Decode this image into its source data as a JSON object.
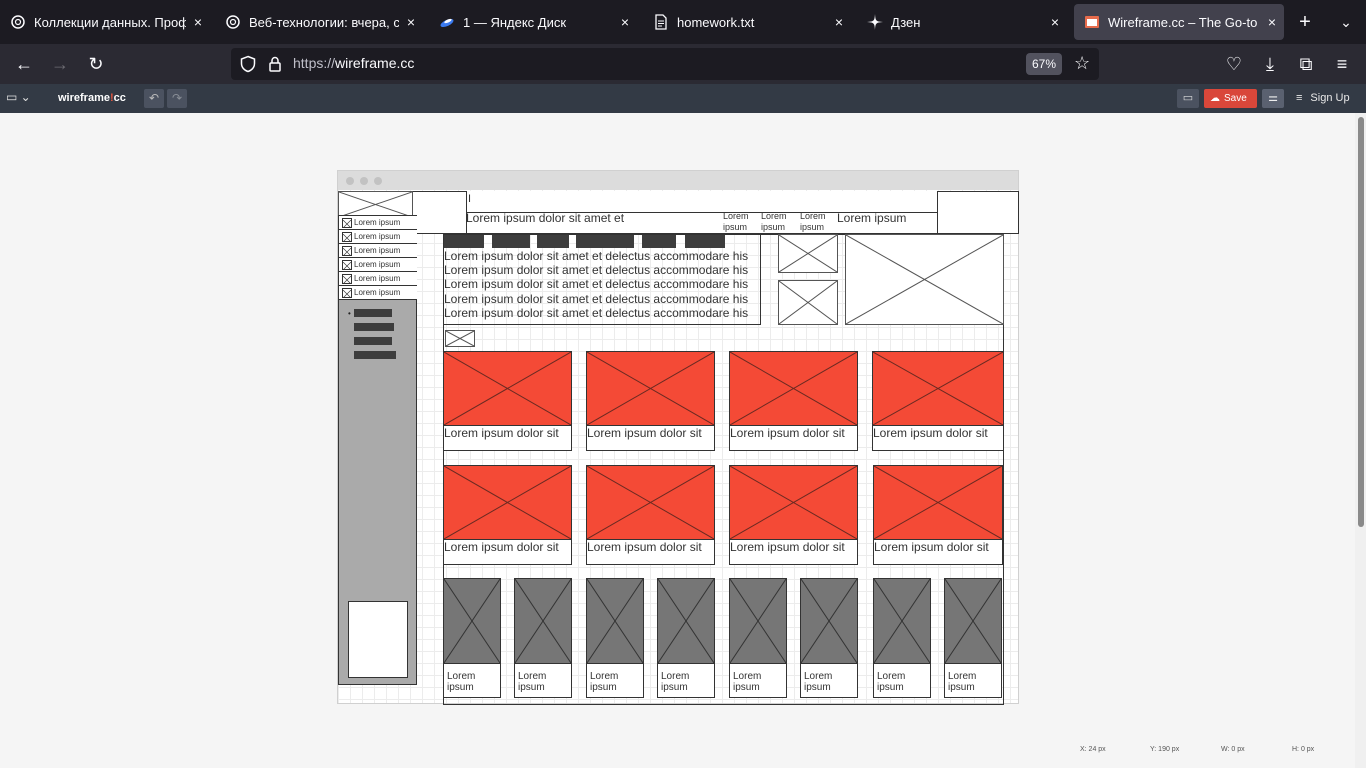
{
  "browser": {
    "tabs": [
      {
        "title": "Коллекции данных. Профиль",
        "close": "×",
        "active": false
      },
      {
        "title": "Веб-технологии: вчера, сего",
        "close": "×",
        "active": false
      },
      {
        "title": "1 — Яндекс Диск",
        "close": "×",
        "active": false
      },
      {
        "title": "homework.txt",
        "close": "×",
        "active": false
      },
      {
        "title": "Дзен",
        "close": "×",
        "active": false
      },
      {
        "title": "Wireframe.cc – The Go-to Fre",
        "close": "×",
        "active": true
      }
    ],
    "new_tab": "+",
    "tabs_menu": "⌄",
    "back": "←",
    "forward": "→",
    "reload": "↻",
    "url_scheme": "https://",
    "url_host": "wireframe.cc",
    "zoom": "67%",
    "bookmark_star": "☆",
    "pocket": "♡",
    "download": "⤓",
    "extensions": "⧉",
    "menu": "≡"
  },
  "app": {
    "pages_icon": "▭ ⌄",
    "logo_left": "wireframe",
    "logo_bang": "!",
    "logo_right": "cc",
    "undo": "↶",
    "redo": "↷",
    "comment": "▭",
    "save_icon": "☁",
    "save": "Save",
    "adjust": "⚌",
    "burger": "≡",
    "signup": "Sign Up"
  },
  "wireframe": {
    "header_input_cursor": "I",
    "header_tagline": "Lorem ipsum dolor sit amet et",
    "header_nav": [
      "Lorem ipsum",
      "Lorem ipsum",
      "Lorem ipsum"
    ],
    "header_nav_large": "Lorem ipsum",
    "sidebar_items": [
      "Lorem ipsum",
      "Lorem ipsum",
      "Lorem ipsum",
      "Lorem ipsum",
      "Lorem ipsum",
      "Lorem ipsum"
    ],
    "sidebar_bullet": "•",
    "paragraph_lines": [
      "Lorem ipsum dolor sit amet et delectus accommodare his",
      "Lorem ipsum dolor sit amet et delectus accommodare his",
      "Lorem ipsum dolor sit amet et delectus accommodare his",
      "Lorem ipsum dolor sit amet et delectus accommodare his",
      "Lorem ipsum dolor sit amet et delectus accommodare his"
    ],
    "card_captions_row1": [
      "Lorem ipsum dolor sit",
      "Lorem ipsum dolor sit",
      "Lorem ipsum dolor sit",
      "Lorem ipsum dolor sit"
    ],
    "card_captions_row2": [
      "Lorem ipsum dolor sit",
      "Lorem ipsum dolor sit",
      "Lorem ipsum dolor sit",
      "Lorem ipsum dolor sit"
    ],
    "thumb_captions": [
      [
        "Lorem",
        "ipsum"
      ],
      [
        "Lorem",
        "ipsum"
      ],
      [
        "Lorem",
        "ipsum"
      ],
      [
        "Lorem",
        "ipsum"
      ],
      [
        "Lorem",
        "ipsum"
      ],
      [
        "Lorem",
        "ipsum"
      ],
      [
        "Lorem",
        "ipsum"
      ],
      [
        "Lorem",
        "ipsum"
      ]
    ],
    "colors": {
      "accent_red": "#f44a36",
      "sidebar_gray": "#aaaaaa",
      "thumb_gray": "#767676",
      "bar_dark": "#3d3d3d"
    }
  },
  "status": {
    "x": "X: 24 px",
    "y": "Y: 190 px",
    "w": "W: 0 px",
    "h": "H: 0 px"
  }
}
